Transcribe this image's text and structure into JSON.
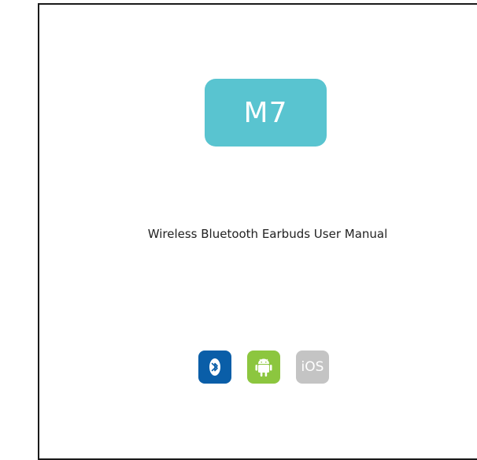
{
  "cover": {
    "model": "M7",
    "subtitle": "Wireless Bluetooth Earbuds User Manual"
  },
  "compatibility_icons": [
    {
      "name": "bluetooth-icon",
      "color": "#0a5ea8"
    },
    {
      "name": "android-icon",
      "color": "#8cc63f"
    },
    {
      "name": "ios-icon",
      "color": "#c4c4c4",
      "label": "iOS"
    }
  ],
  "colors": {
    "badge": "#59c4d0",
    "text": "#222222",
    "border": "#1a1a1a"
  }
}
